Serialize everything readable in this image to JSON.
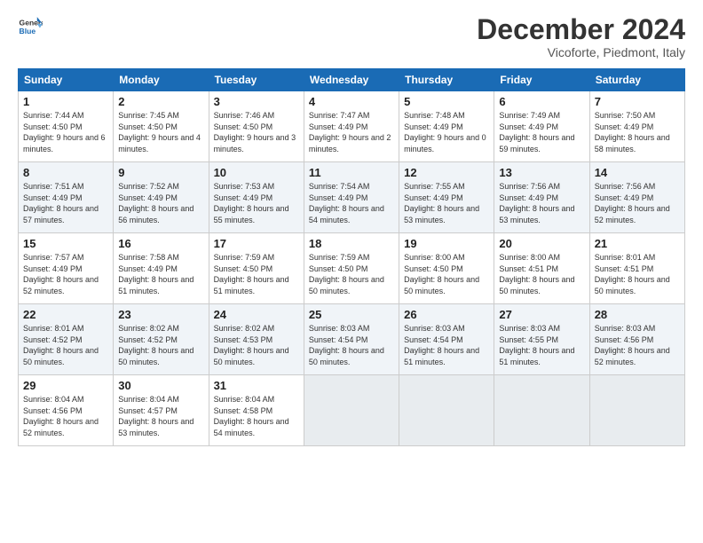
{
  "logo": {
    "text_general": "General",
    "text_blue": "Blue"
  },
  "header": {
    "month": "December 2024",
    "location": "Vicoforte, Piedmont, Italy"
  },
  "weekdays": [
    "Sunday",
    "Monday",
    "Tuesday",
    "Wednesday",
    "Thursday",
    "Friday",
    "Saturday"
  ],
  "weeks": [
    [
      {
        "day": "1",
        "sunrise": "Sunrise: 7:44 AM",
        "sunset": "Sunset: 4:50 PM",
        "daylight": "Daylight: 9 hours and 6 minutes."
      },
      {
        "day": "2",
        "sunrise": "Sunrise: 7:45 AM",
        "sunset": "Sunset: 4:50 PM",
        "daylight": "Daylight: 9 hours and 4 minutes."
      },
      {
        "day": "3",
        "sunrise": "Sunrise: 7:46 AM",
        "sunset": "Sunset: 4:50 PM",
        "daylight": "Daylight: 9 hours and 3 minutes."
      },
      {
        "day": "4",
        "sunrise": "Sunrise: 7:47 AM",
        "sunset": "Sunset: 4:49 PM",
        "daylight": "Daylight: 9 hours and 2 minutes."
      },
      {
        "day": "5",
        "sunrise": "Sunrise: 7:48 AM",
        "sunset": "Sunset: 4:49 PM",
        "daylight": "Daylight: 9 hours and 0 minutes."
      },
      {
        "day": "6",
        "sunrise": "Sunrise: 7:49 AM",
        "sunset": "Sunset: 4:49 PM",
        "daylight": "Daylight: 8 hours and 59 minutes."
      },
      {
        "day": "7",
        "sunrise": "Sunrise: 7:50 AM",
        "sunset": "Sunset: 4:49 PM",
        "daylight": "Daylight: 8 hours and 58 minutes."
      }
    ],
    [
      {
        "day": "8",
        "sunrise": "Sunrise: 7:51 AM",
        "sunset": "Sunset: 4:49 PM",
        "daylight": "Daylight: 8 hours and 57 minutes."
      },
      {
        "day": "9",
        "sunrise": "Sunrise: 7:52 AM",
        "sunset": "Sunset: 4:49 PM",
        "daylight": "Daylight: 8 hours and 56 minutes."
      },
      {
        "day": "10",
        "sunrise": "Sunrise: 7:53 AM",
        "sunset": "Sunset: 4:49 PM",
        "daylight": "Daylight: 8 hours and 55 minutes."
      },
      {
        "day": "11",
        "sunrise": "Sunrise: 7:54 AM",
        "sunset": "Sunset: 4:49 PM",
        "daylight": "Daylight: 8 hours and 54 minutes."
      },
      {
        "day": "12",
        "sunrise": "Sunrise: 7:55 AM",
        "sunset": "Sunset: 4:49 PM",
        "daylight": "Daylight: 8 hours and 53 minutes."
      },
      {
        "day": "13",
        "sunrise": "Sunrise: 7:56 AM",
        "sunset": "Sunset: 4:49 PM",
        "daylight": "Daylight: 8 hours and 53 minutes."
      },
      {
        "day": "14",
        "sunrise": "Sunrise: 7:56 AM",
        "sunset": "Sunset: 4:49 PM",
        "daylight": "Daylight: 8 hours and 52 minutes."
      }
    ],
    [
      {
        "day": "15",
        "sunrise": "Sunrise: 7:57 AM",
        "sunset": "Sunset: 4:49 PM",
        "daylight": "Daylight: 8 hours and 52 minutes."
      },
      {
        "day": "16",
        "sunrise": "Sunrise: 7:58 AM",
        "sunset": "Sunset: 4:49 PM",
        "daylight": "Daylight: 8 hours and 51 minutes."
      },
      {
        "day": "17",
        "sunrise": "Sunrise: 7:59 AM",
        "sunset": "Sunset: 4:50 PM",
        "daylight": "Daylight: 8 hours and 51 minutes."
      },
      {
        "day": "18",
        "sunrise": "Sunrise: 7:59 AM",
        "sunset": "Sunset: 4:50 PM",
        "daylight": "Daylight: 8 hours and 50 minutes."
      },
      {
        "day": "19",
        "sunrise": "Sunrise: 8:00 AM",
        "sunset": "Sunset: 4:50 PM",
        "daylight": "Daylight: 8 hours and 50 minutes."
      },
      {
        "day": "20",
        "sunrise": "Sunrise: 8:00 AM",
        "sunset": "Sunset: 4:51 PM",
        "daylight": "Daylight: 8 hours and 50 minutes."
      },
      {
        "day": "21",
        "sunrise": "Sunrise: 8:01 AM",
        "sunset": "Sunset: 4:51 PM",
        "daylight": "Daylight: 8 hours and 50 minutes."
      }
    ],
    [
      {
        "day": "22",
        "sunrise": "Sunrise: 8:01 AM",
        "sunset": "Sunset: 4:52 PM",
        "daylight": "Daylight: 8 hours and 50 minutes."
      },
      {
        "day": "23",
        "sunrise": "Sunrise: 8:02 AM",
        "sunset": "Sunset: 4:52 PM",
        "daylight": "Daylight: 8 hours and 50 minutes."
      },
      {
        "day": "24",
        "sunrise": "Sunrise: 8:02 AM",
        "sunset": "Sunset: 4:53 PM",
        "daylight": "Daylight: 8 hours and 50 minutes."
      },
      {
        "day": "25",
        "sunrise": "Sunrise: 8:03 AM",
        "sunset": "Sunset: 4:54 PM",
        "daylight": "Daylight: 8 hours and 50 minutes."
      },
      {
        "day": "26",
        "sunrise": "Sunrise: 8:03 AM",
        "sunset": "Sunset: 4:54 PM",
        "daylight": "Daylight: 8 hours and 51 minutes."
      },
      {
        "day": "27",
        "sunrise": "Sunrise: 8:03 AM",
        "sunset": "Sunset: 4:55 PM",
        "daylight": "Daylight: 8 hours and 51 minutes."
      },
      {
        "day": "28",
        "sunrise": "Sunrise: 8:03 AM",
        "sunset": "Sunset: 4:56 PM",
        "daylight": "Daylight: 8 hours and 52 minutes."
      }
    ],
    [
      {
        "day": "29",
        "sunrise": "Sunrise: 8:04 AM",
        "sunset": "Sunset: 4:56 PM",
        "daylight": "Daylight: 8 hours and 52 minutes."
      },
      {
        "day": "30",
        "sunrise": "Sunrise: 8:04 AM",
        "sunset": "Sunset: 4:57 PM",
        "daylight": "Daylight: 8 hours and 53 minutes."
      },
      {
        "day": "31",
        "sunrise": "Sunrise: 8:04 AM",
        "sunset": "Sunset: 4:58 PM",
        "daylight": "Daylight: 8 hours and 54 minutes."
      },
      null,
      null,
      null,
      null
    ]
  ]
}
